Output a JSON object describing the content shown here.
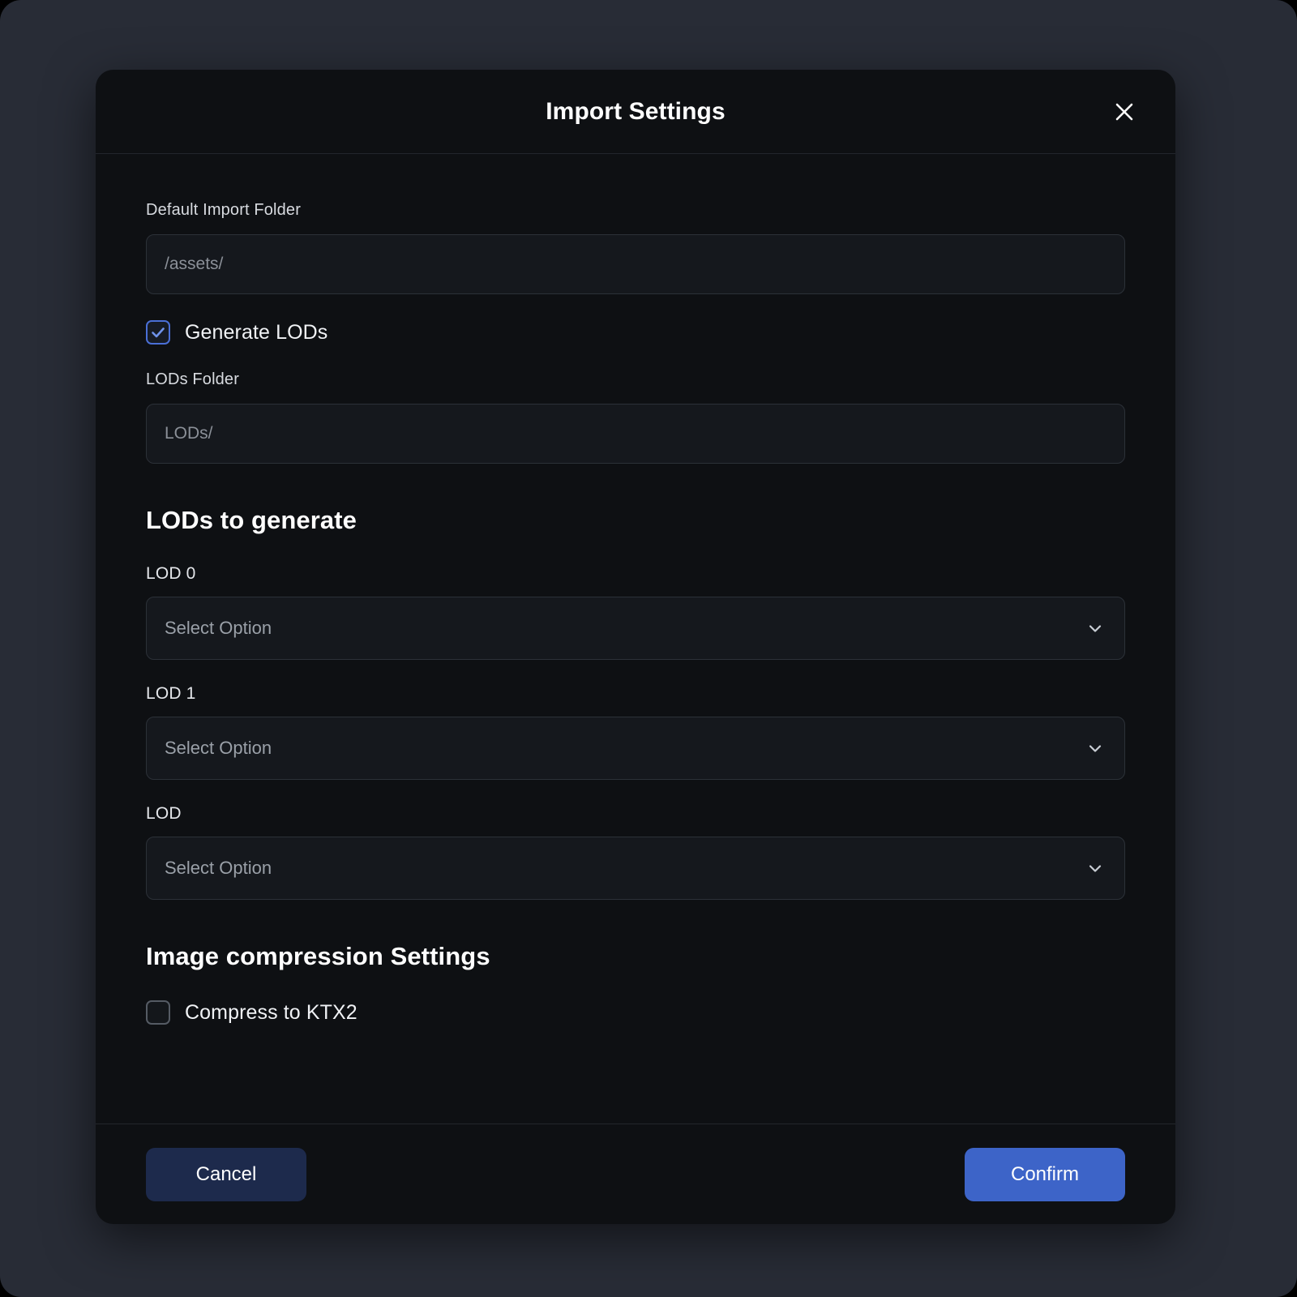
{
  "modal": {
    "title": "Import Settings",
    "close_icon": "close-icon"
  },
  "form": {
    "default_import_folder": {
      "label": "Default Import Folder",
      "placeholder": "/assets/",
      "value": ""
    },
    "generate_lods": {
      "label": "Generate LODs",
      "checked": true
    },
    "lods_folder": {
      "label": "LODs Folder",
      "placeholder": "LODs/",
      "value": ""
    }
  },
  "lods_section": {
    "heading": "LODs to generate",
    "items": [
      {
        "label": "LOD 0",
        "value": "Select Option",
        "chevron_icon": "chevron-down-icon"
      },
      {
        "label": "LOD 1",
        "value": "Select Option",
        "chevron_icon": "chevron-down-icon"
      },
      {
        "label": "LOD",
        "value": "Select Option",
        "chevron_icon": "chevron-down-icon"
      }
    ]
  },
  "compression_section": {
    "heading": "Image compression Settings",
    "compress_ktx2": {
      "label": "Compress to KTX2",
      "checked": false
    }
  },
  "footer": {
    "cancel_label": "Cancel",
    "confirm_label": "Confirm"
  },
  "colors": {
    "page_background": "#282c36",
    "modal_background": "#0e1013",
    "field_background": "#15181d",
    "field_border": "#2c3138",
    "accent_blue": "#3d64c8",
    "cancel_navy": "#1d2a4c",
    "checkbox_checked_border": "#4a6fd6",
    "placeholder_text": "#8b9098"
  }
}
